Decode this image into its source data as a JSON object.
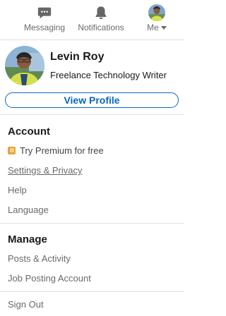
{
  "nav": {
    "messaging_label": "Messaging",
    "notifications_label": "Notifications",
    "me_label": "Me"
  },
  "profile": {
    "name": "Levin Roy",
    "headline": "Freelance Technology Writer",
    "view_profile_label": "View Profile"
  },
  "account": {
    "title": "Account",
    "premium_label": "Try Premium for free",
    "settings_label": "Settings & Privacy",
    "help_label": "Help",
    "language_label": "Language"
  },
  "manage": {
    "title": "Manage",
    "posts_label": "Posts & Activity",
    "job_posting_label": "Job Posting Account"
  },
  "sign_out_label": "Sign Out",
  "colors": {
    "accent": "#0a66c2",
    "premium": "#e7a33e"
  },
  "icons": {
    "messaging": "messaging-icon",
    "notifications": "bell-icon",
    "me_caret": "caret-down-icon",
    "premium": "premium-icon"
  }
}
